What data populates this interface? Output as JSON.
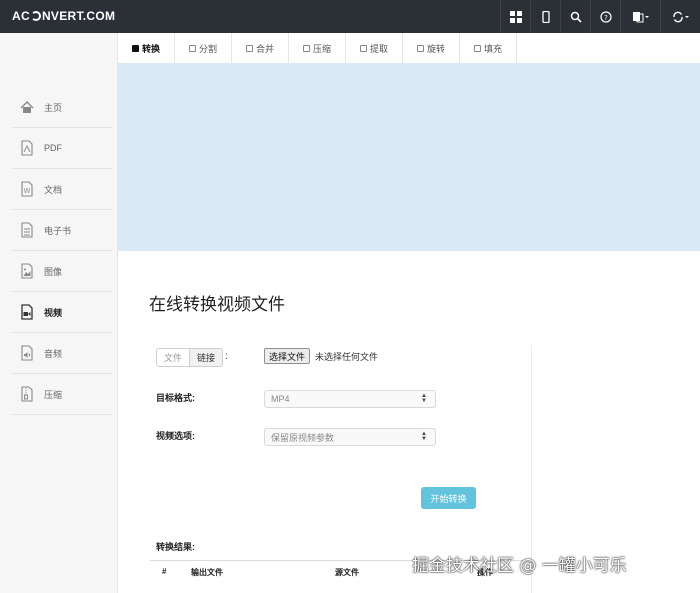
{
  "header": {
    "logo_left": "AC",
    "logo_right": "NVERT.COM",
    "icons": [
      "grid-icon",
      "phone-icon",
      "search-icon",
      "help-icon",
      "language-icon",
      "sync-icon"
    ]
  },
  "sidebar": {
    "items": [
      {
        "label": "主页",
        "icon": "home-icon"
      },
      {
        "label": "PDF",
        "icon": "pdf-icon"
      },
      {
        "label": "文档",
        "icon": "document-icon"
      },
      {
        "label": "电子书",
        "icon": "ebook-icon"
      },
      {
        "label": "图像",
        "icon": "image-icon"
      },
      {
        "label": "视频",
        "icon": "video-icon",
        "active": true
      },
      {
        "label": "音频",
        "icon": "audio-icon"
      },
      {
        "label": "压缩",
        "icon": "archive-icon"
      }
    ]
  },
  "tabs": [
    {
      "label": "转换",
      "active": true
    },
    {
      "label": "分割"
    },
    {
      "label": "合并"
    },
    {
      "label": "压缩"
    },
    {
      "label": "提取"
    },
    {
      "label": "旋转"
    },
    {
      "label": "填充"
    }
  ],
  "main": {
    "title": "在线转换视频文件",
    "source_toggle": {
      "file": "文件",
      "link": "链接",
      "colon": ":"
    },
    "file_input": {
      "button": "选择文件",
      "status": "未选择任何文件"
    },
    "target_format": {
      "label": "目标格式:",
      "value": "MP4"
    },
    "video_options": {
      "label": "视频选项:",
      "value": "保留原视频参数"
    },
    "start_button": "开始转换",
    "results": {
      "label": "转换结果:",
      "columns": [
        "#",
        "输出文件",
        "源文件",
        "操作"
      ]
    }
  },
  "watermark": "掘金技术社区 @ 一罐小可乐",
  "colors": {
    "topbar": "#2b2f36",
    "banner": "#d9eaf4",
    "accent_button": "#62c3dc",
    "sidebar_bg": "#f6f6f6"
  }
}
